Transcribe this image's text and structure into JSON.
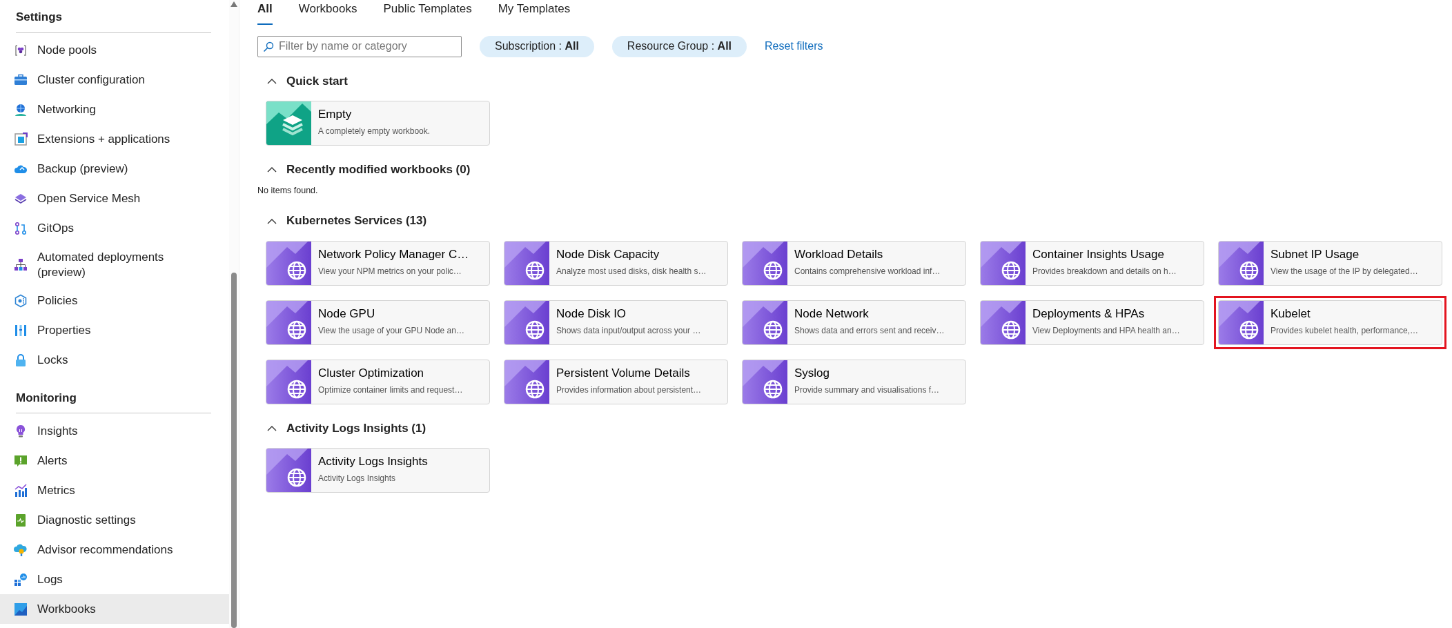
{
  "sidebar": {
    "groups": [
      {
        "title": "Settings",
        "items": [
          {
            "label": "Node pools",
            "selected": false
          },
          {
            "label": "Cluster configuration",
            "selected": false
          },
          {
            "label": "Networking",
            "selected": false
          },
          {
            "label": "Extensions + applications",
            "selected": false
          },
          {
            "label": "Backup (preview)",
            "selected": false
          },
          {
            "label": "Open Service Mesh",
            "selected": false
          },
          {
            "label": "GitOps",
            "selected": false
          },
          {
            "label": "Automated deployments (preview)",
            "selected": false
          },
          {
            "label": "Policies",
            "selected": false
          },
          {
            "label": "Properties",
            "selected": false
          },
          {
            "label": "Locks",
            "selected": false
          }
        ]
      },
      {
        "title": "Monitoring",
        "items": [
          {
            "label": "Insights",
            "selected": false
          },
          {
            "label": "Alerts",
            "selected": false
          },
          {
            "label": "Metrics",
            "selected": false
          },
          {
            "label": "Diagnostic settings",
            "selected": false
          },
          {
            "label": "Advisor recommendations",
            "selected": false
          },
          {
            "label": "Logs",
            "selected": false
          },
          {
            "label": "Workbooks",
            "selected": true
          }
        ]
      }
    ]
  },
  "tabs": [
    {
      "label": "All",
      "selected": true
    },
    {
      "label": "Workbooks",
      "selected": false
    },
    {
      "label": "Public Templates",
      "selected": false
    },
    {
      "label": "My Templates",
      "selected": false
    }
  ],
  "filter": {
    "placeholder": "Filter by name or category"
  },
  "pills": [
    "Subscription : **All**",
    "Resource Group : **All**"
  ],
  "reset_link": "Reset filters",
  "sections": [
    {
      "title": "Quick start",
      "expanded": true,
      "items": [
        {
          "kind": "empty",
          "title": "Empty",
          "description": "A completely empty workbook.",
          "highlighted": false
        }
      ]
    },
    {
      "title": "Recently modified workbooks (0)",
      "expanded": true,
      "empty_text": "No items found."
    },
    {
      "title": "Kubernetes Services (13)",
      "expanded": true,
      "items": [
        {
          "kind": "template",
          "title": "Network Policy Manager C…",
          "description": "View your NPM metrics on your polic…",
          "highlighted": false
        },
        {
          "kind": "template",
          "title": "Node Disk Capacity",
          "description": "Analyze most used disks, disk health s…",
          "highlighted": false
        },
        {
          "kind": "template",
          "title": "Workload Details",
          "description": "Contains comprehensive workload inf…",
          "highlighted": false
        },
        {
          "kind": "template",
          "title": "Container Insights Usage",
          "description": "Provides breakdown and details on h…",
          "highlighted": false
        },
        {
          "kind": "template",
          "title": "Subnet IP Usage",
          "description": "View the usage of the IP by delegated…",
          "highlighted": false
        },
        {
          "kind": "template",
          "title": "Node GPU",
          "description": "View the usage of your GPU Node an…",
          "highlighted": false
        },
        {
          "kind": "template",
          "title": "Node Disk IO",
          "description": "Shows data input/output across your …",
          "highlighted": false
        },
        {
          "kind": "template",
          "title": "Node Network",
          "description": "Shows data and errors sent and receiv…",
          "highlighted": false
        },
        {
          "kind": "template",
          "title": "Deployments & HPAs",
          "description": "View Deployments and HPA health an…",
          "highlighted": false
        },
        {
          "kind": "template",
          "title": "Kubelet",
          "description": "Provides kubelet health, performance,…",
          "highlighted": true
        },
        {
          "kind": "template",
          "title": "Cluster Optimization",
          "description": "Optimize container limits and request…",
          "highlighted": false
        },
        {
          "kind": "template",
          "title": "Persistent Volume Details",
          "description": "Provides information about persistent…",
          "highlighted": false
        },
        {
          "kind": "template",
          "title": "Syslog",
          "description": "Provide summary and visualisations f…",
          "highlighted": false
        }
      ]
    },
    {
      "title": "Activity Logs Insights (1)",
      "expanded": true,
      "items": [
        {
          "kind": "template",
          "title": "Activity Logs Insights",
          "description": "Activity Logs Insights",
          "highlighted": false
        }
      ]
    }
  ]
}
